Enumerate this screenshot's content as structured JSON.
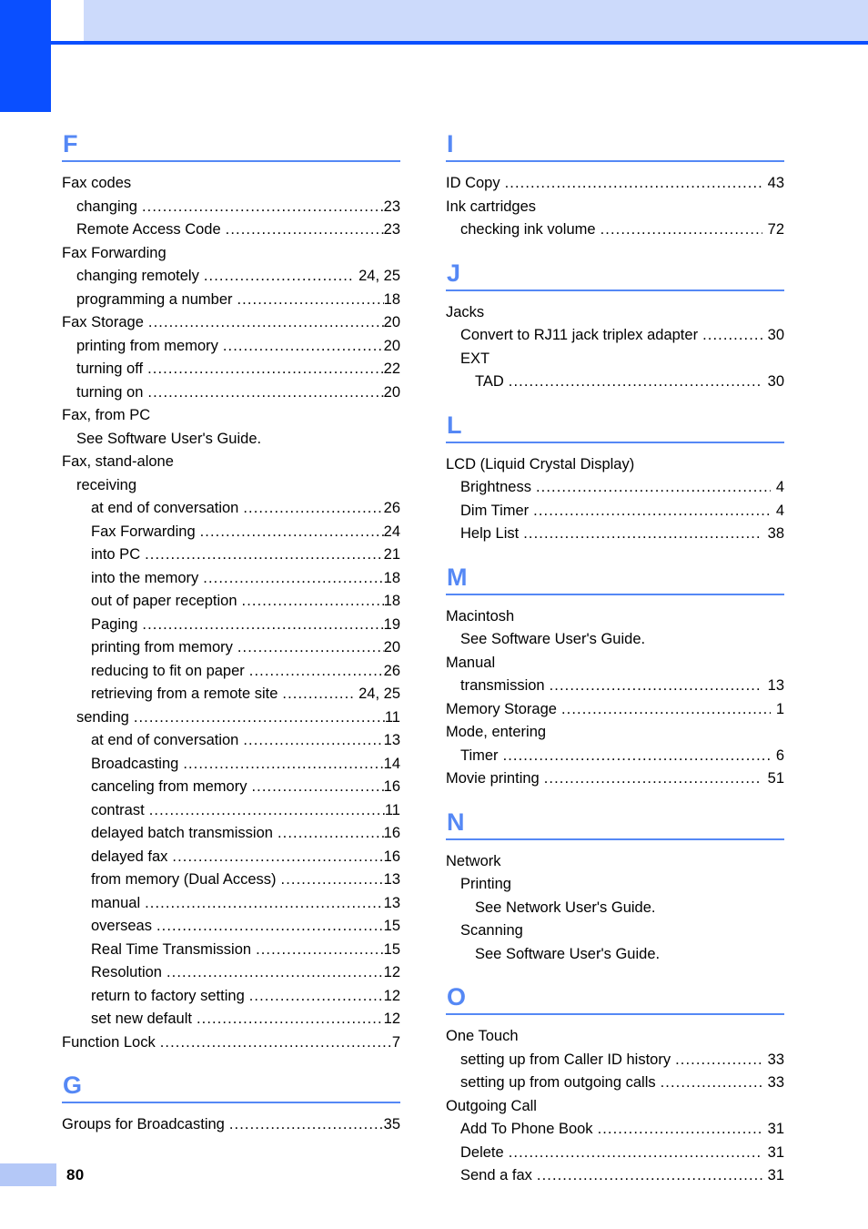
{
  "document": {
    "page_number": "80",
    "colors": {
      "header_tab": "#0A4FFF",
      "header_banner": "#CCDAFB",
      "header_rule": "#0A4FFF",
      "section_heading": "#5588F5",
      "footer_block": "#B4C8F7",
      "text": "#000000"
    }
  },
  "columns": {
    "left": [
      {
        "letter": "F",
        "entries": [
          {
            "indent": 0,
            "label": "Fax codes",
            "pages": "",
            "leader": false
          },
          {
            "indent": 1,
            "label": "changing",
            "pages": "23",
            "leader": true
          },
          {
            "indent": 1,
            "label": "Remote Access Code",
            "pages": "23",
            "leader": true
          },
          {
            "indent": 0,
            "label": "Fax Forwarding",
            "pages": "",
            "leader": false
          },
          {
            "indent": 1,
            "label": "changing remotely",
            "pages": "24, 25",
            "leader": true,
            "multi": true
          },
          {
            "indent": 1,
            "label": "programming a number",
            "pages": "18",
            "leader": true
          },
          {
            "indent": 0,
            "label": "Fax Storage",
            "pages": "20",
            "leader": true
          },
          {
            "indent": 1,
            "label": "printing from memory",
            "pages": "20",
            "leader": true
          },
          {
            "indent": 1,
            "label": "turning off",
            "pages": "22",
            "leader": true
          },
          {
            "indent": 1,
            "label": "turning on",
            "pages": "20",
            "leader": true
          },
          {
            "indent": 0,
            "label": "Fax, from PC",
            "pages": "",
            "leader": false
          },
          {
            "indent": 1,
            "label": "See Software User's Guide.",
            "pages": "",
            "leader": false
          },
          {
            "indent": 0,
            "label": "Fax, stand-alone",
            "pages": "",
            "leader": false
          },
          {
            "indent": 1,
            "label": "receiving",
            "pages": "",
            "leader": false
          },
          {
            "indent": 2,
            "label": "at end of conversation",
            "pages": "26",
            "leader": true
          },
          {
            "indent": 2,
            "label": "Fax Forwarding",
            "pages": "24",
            "leader": true
          },
          {
            "indent": 2,
            "label": "into PC",
            "pages": "21",
            "leader": true
          },
          {
            "indent": 2,
            "label": "into the memory",
            "pages": "18",
            "leader": true
          },
          {
            "indent": 2,
            "label": "out of paper reception",
            "pages": "18",
            "leader": true
          },
          {
            "indent": 2,
            "label": "Paging",
            "pages": "19",
            "leader": true
          },
          {
            "indent": 2,
            "label": "printing from memory",
            "pages": "20",
            "leader": true
          },
          {
            "indent": 2,
            "label": "reducing to fit on paper",
            "pages": "26",
            "leader": true
          },
          {
            "indent": 2,
            "label": "retrieving from a remote site",
            "pages": "24, 25",
            "leader": true,
            "multi": true
          },
          {
            "indent": 1,
            "label": "sending",
            "pages": "11",
            "leader": true
          },
          {
            "indent": 2,
            "label": "at end of conversation",
            "pages": "13",
            "leader": true
          },
          {
            "indent": 2,
            "label": "Broadcasting",
            "pages": "14",
            "leader": true
          },
          {
            "indent": 2,
            "label": "canceling from memory",
            "pages": "16",
            "leader": true
          },
          {
            "indent": 2,
            "label": "contrast",
            "pages": "11",
            "leader": true
          },
          {
            "indent": 2,
            "label": "delayed batch transmission",
            "pages": "16",
            "leader": true
          },
          {
            "indent": 2,
            "label": "delayed fax",
            "pages": "16",
            "leader": true
          },
          {
            "indent": 2,
            "label": "from memory (Dual Access)",
            "pages": "13",
            "leader": true
          },
          {
            "indent": 2,
            "label": "manual",
            "pages": "13",
            "leader": true
          },
          {
            "indent": 2,
            "label": "overseas",
            "pages": "15",
            "leader": true
          },
          {
            "indent": 2,
            "label": "Real Time Transmission",
            "pages": "15",
            "leader": true
          },
          {
            "indent": 2,
            "label": "Resolution",
            "pages": "12",
            "leader": true
          },
          {
            "indent": 2,
            "label": "return to factory setting",
            "pages": "12",
            "leader": true
          },
          {
            "indent": 2,
            "label": "set new default",
            "pages": "12",
            "leader": true
          },
          {
            "indent": 0,
            "label": "Function Lock",
            "pages": "7",
            "leader": true
          }
        ]
      },
      {
        "letter": "G",
        "entries": [
          {
            "indent": 0,
            "label": "Groups for Broadcasting",
            "pages": "35",
            "leader": true
          }
        ]
      }
    ],
    "right": [
      {
        "letter": "I",
        "entries": [
          {
            "indent": 0,
            "label": "ID Copy",
            "pages": "43",
            "leader": true
          },
          {
            "indent": 0,
            "label": "Ink cartridges",
            "pages": "",
            "leader": false
          },
          {
            "indent": 1,
            "label": "checking ink volume",
            "pages": "72",
            "leader": true
          }
        ]
      },
      {
        "letter": "J",
        "entries": [
          {
            "indent": 0,
            "label": "Jacks",
            "pages": "",
            "leader": false
          },
          {
            "indent": 1,
            "label": "Convert to RJ11 jack triplex adapter",
            "pages": "30",
            "leader": true
          },
          {
            "indent": 1,
            "label": "EXT",
            "pages": "",
            "leader": false
          },
          {
            "indent": 2,
            "label": "TAD",
            "pages": "30",
            "leader": true
          }
        ]
      },
      {
        "letter": "L",
        "entries": [
          {
            "indent": 0,
            "label": "LCD (Liquid Crystal Display)",
            "pages": "",
            "leader": false
          },
          {
            "indent": 1,
            "label": "Brightness",
            "pages": "4",
            "leader": true
          },
          {
            "indent": 1,
            "label": "Dim Timer",
            "pages": "4",
            "leader": true
          },
          {
            "indent": 1,
            "label": "Help List",
            "pages": "38",
            "leader": true
          }
        ]
      },
      {
        "letter": "M",
        "entries": [
          {
            "indent": 0,
            "label": "Macintosh",
            "pages": "",
            "leader": false
          },
          {
            "indent": 1,
            "label": "See Software User's Guide.",
            "pages": "",
            "leader": false
          },
          {
            "indent": 0,
            "label": "Manual",
            "pages": "",
            "leader": false
          },
          {
            "indent": 1,
            "label": "transmission",
            "pages": "13",
            "leader": true
          },
          {
            "indent": 0,
            "label": "Memory Storage",
            "pages": "1",
            "leader": true
          },
          {
            "indent": 0,
            "label": "Mode, entering",
            "pages": "",
            "leader": false
          },
          {
            "indent": 1,
            "label": "Timer",
            "pages": "6",
            "leader": true
          },
          {
            "indent": 0,
            "label": "Movie printing",
            "pages": "51",
            "leader": true
          }
        ]
      },
      {
        "letter": "N",
        "entries": [
          {
            "indent": 0,
            "label": "Network",
            "pages": "",
            "leader": false
          },
          {
            "indent": 1,
            "label": "Printing",
            "pages": "",
            "leader": false
          },
          {
            "indent": 2,
            "label": "See Network User's Guide.",
            "pages": "",
            "leader": false
          },
          {
            "indent": 1,
            "label": "Scanning",
            "pages": "",
            "leader": false
          },
          {
            "indent": 2,
            "label": "See Software User's Guide.",
            "pages": "",
            "leader": false
          }
        ]
      },
      {
        "letter": "O",
        "entries": [
          {
            "indent": 0,
            "label": "One Touch",
            "pages": "",
            "leader": false
          },
          {
            "indent": 1,
            "label": "setting up from Caller ID history",
            "pages": "33",
            "leader": true
          },
          {
            "indent": 1,
            "label": "setting up from outgoing calls",
            "pages": "33",
            "leader": true
          },
          {
            "indent": 0,
            "label": "Outgoing Call",
            "pages": "",
            "leader": false
          },
          {
            "indent": 1,
            "label": "Add To Phone Book",
            "pages": "31",
            "leader": true
          },
          {
            "indent": 1,
            "label": "Delete",
            "pages": "31",
            "leader": true
          },
          {
            "indent": 1,
            "label": "Send a fax",
            "pages": "31",
            "leader": true
          }
        ]
      }
    ]
  }
}
